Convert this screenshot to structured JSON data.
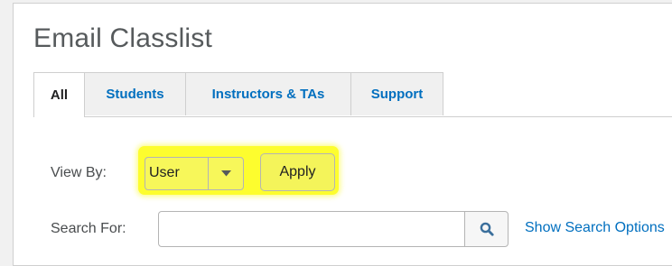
{
  "page": {
    "title": "Email Classlist"
  },
  "tabs": [
    {
      "label": "All",
      "active": true
    },
    {
      "label": "Students",
      "active": false
    },
    {
      "label": "Instructors & TAs",
      "active": false
    },
    {
      "label": "Support",
      "active": false
    }
  ],
  "view_by": {
    "label": "View By:",
    "selected": "User",
    "arrow_icon": "caret-down-icon",
    "highlight_color": "#fdfd2e"
  },
  "apply_button": {
    "label": "Apply"
  },
  "search": {
    "label": "Search For:",
    "value": "",
    "button_icon": "search-icon",
    "options_link": "Show Search Options",
    "link_color": "#006fbf"
  }
}
